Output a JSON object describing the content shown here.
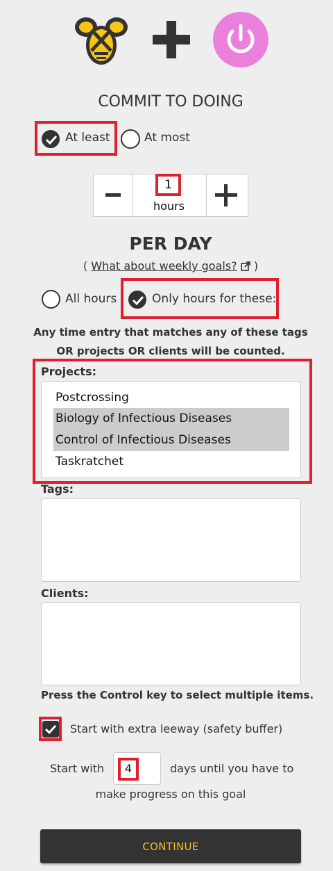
{
  "header": {
    "logo_icon": "beeminder-bee-icon",
    "plus_icon": "plus-icon",
    "integration_icon": "power-icon",
    "integration_color": "#ea7fdc"
  },
  "commit": {
    "title": "COMMIT TO DOING",
    "at_least_label": "At least",
    "at_most_label": "At most",
    "selected": "at_least"
  },
  "stepper": {
    "value": "1",
    "unit": "hours",
    "minus_label": "−",
    "plus_label": "+"
  },
  "period": {
    "title": "PER DAY",
    "link_open": "(",
    "link_text": "What about weekly goals?",
    "link_close": ")"
  },
  "filter_mode": {
    "all_label": "All hours",
    "only_label": "Only hours for these:",
    "selected": "only"
  },
  "help_text": {
    "line1": "Any time entry that matches any of these tags",
    "line2": "OR projects OR clients will be counted."
  },
  "projects": {
    "label": "Projects:",
    "items": [
      {
        "label": "Postcrossing",
        "selected": false
      },
      {
        "label": "Biology of Infectious Diseases",
        "selected": true
      },
      {
        "label": "Control of Infectious Diseases",
        "selected": true
      },
      {
        "label": "Taskratchet",
        "selected": false
      }
    ]
  },
  "tags": {
    "label": "Tags:"
  },
  "clients": {
    "label": "Clients:"
  },
  "control_hint": "Press the Control key to select multiple items.",
  "leeway": {
    "label": "Start with extra leeway (safety buffer)",
    "checked": true
  },
  "start": {
    "prefix": "Start with",
    "value": "4",
    "suffix": "days until you have to",
    "line2": "make progress on this goal"
  },
  "continue_label": "CONTINUE",
  "colors": {
    "highlight": "#e0202e",
    "button": "#333333",
    "button_text": "#f0c020",
    "bee_yellow": "#f5c518"
  }
}
